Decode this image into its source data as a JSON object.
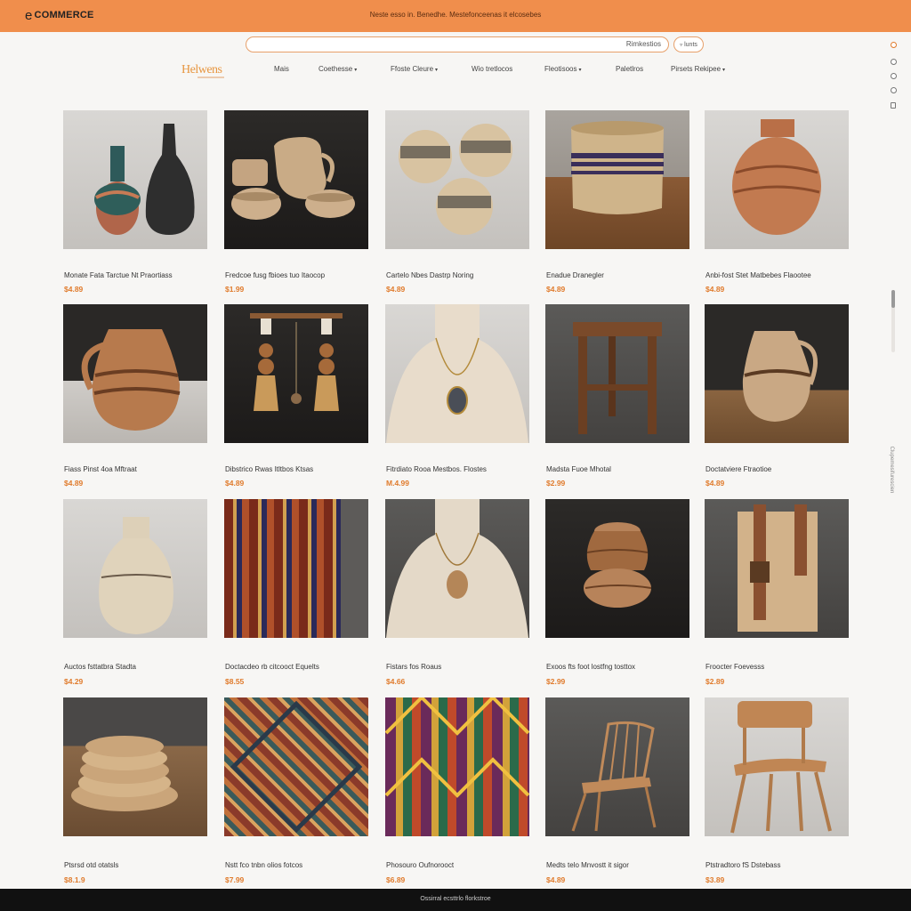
{
  "header": {
    "brand": "COMMERCE",
    "brand_mark": "e",
    "promo": "Neste esso in. Benedhe. Mestefonceenas it elcosebes",
    "search_label": "Rimkestios",
    "search_pill": "lunts",
    "logo": "Helwens"
  },
  "nav": [
    {
      "label": "Mais",
      "has_dropdown": false
    },
    {
      "label": "Coethesse",
      "has_dropdown": true
    },
    {
      "label": "Ffoste Cleure",
      "has_dropdown": true
    },
    {
      "label": "Wio tretlocos",
      "has_dropdown": false
    },
    {
      "label": "Fleotisoos",
      "has_dropdown": true
    },
    {
      "label": "Paletlros",
      "has_dropdown": false
    },
    {
      "label": "Pirsets Rekipee",
      "has_dropdown": true
    }
  ],
  "rail": {
    "icons": [
      "cart-icon",
      "circle-icon",
      "circle-icon",
      "circle-icon",
      "document-icon"
    ],
    "vertical_text": "Clupemesifurescien"
  },
  "products": [
    {
      "name": "Monate Fata Tarctue Nt Praortiass",
      "price": "$4.89",
      "art": "vases-pair"
    },
    {
      "name": "Fredcoe fusg fbioes tuo Itaocop",
      "price": "$1.99",
      "art": "clay-set"
    },
    {
      "name": "Cartelo Nbes Dastrp Noring",
      "price": "$4.89",
      "art": "bowls-patterned"
    },
    {
      "name": "Enadue Dranegler",
      "price": "$4.89",
      "art": "woven-basket"
    },
    {
      "name": "Anbi-fost Stet Matbebes Flaootee",
      "price": "$4.89",
      "art": "terracotta-urn"
    },
    {
      "name": "Fiass Pinst 4oa Mftraat",
      "price": "$4.89",
      "art": "patterned-jug"
    },
    {
      "name": "Dibstrico Rwas Itltbos Ktsas",
      "price": "$4.89",
      "art": "earrings-stand"
    },
    {
      "name": "Fitrdiato Rooa Mestbos. Flostes",
      "price": "M.4.99",
      "art": "necklace-bust"
    },
    {
      "name": "Madsta Fuoe Mhotal",
      "price": "$2.99",
      "art": "wood-stool"
    },
    {
      "name": "Doctatviere Ftraotioe",
      "price": "$4.89",
      "art": "painted-jug"
    },
    {
      "name": "Auctos fsttatbra Stadta",
      "price": "$4.29",
      "art": "cream-vase"
    },
    {
      "name": "Doctacdeo rb citcooct Equelts",
      "price": "$8.55",
      "art": "red-textile"
    },
    {
      "name": "Fistars fos Roaus",
      "price": "$4.66",
      "art": "pendant-bust"
    },
    {
      "name": "Exoos fts foot lostfng tosttox",
      "price": "$2.99",
      "art": "stacked-vessel"
    },
    {
      "name": "Froocter Foevesss",
      "price": "$2.89",
      "art": "wood-carvings"
    },
    {
      "name": "Ptsrsd otd otatsls",
      "price": "$8.1.9",
      "art": "woven-coasters"
    },
    {
      "name": "Nstt fco tnbn olios fotcos",
      "price": "$7.99",
      "art": "diamond-rug"
    },
    {
      "name": "Phosouro Oufnorooct",
      "price": "$6.89",
      "art": "kilim-rug"
    },
    {
      "name": "Medts telo Mnvostt it sigor",
      "price": "$4.89",
      "art": "spindle-chair"
    },
    {
      "name": "Ptstradtoro fS Dstebass",
      "price": "$3.89",
      "art": "modern-chair"
    }
  ],
  "footer": {
    "text": "Ossirral ecsttrlo florkstroe"
  }
}
